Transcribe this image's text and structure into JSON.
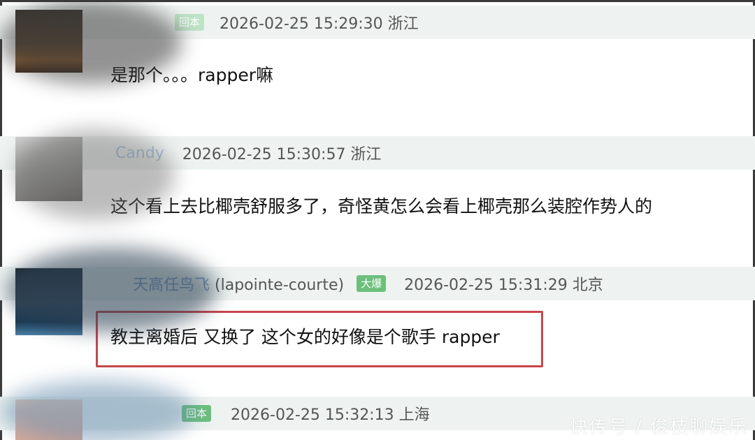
{
  "comments": [
    {
      "username": "",
      "handle": "",
      "badge": "回本",
      "timestamp": "2026-02-25 15:29:30 浙江",
      "text": "是那个。。。rapper嘛"
    },
    {
      "username": "Candy",
      "handle": "",
      "badge": "",
      "timestamp": "2026-02-25 15:30:57 浙江",
      "text": "这个看上去比椰壳舒服多了，奇怪黄怎么会看上椰壳那么装腔作势人的"
    },
    {
      "username": "天高任鸟飞",
      "handle": "(lapointe-courte)",
      "badge": "大爆",
      "timestamp": "2026-02-25 15:31:29 北京",
      "text": "教主离婚后 又换了 这个女的好像是个歌手 rapper"
    },
    {
      "username": "",
      "handle": "",
      "badge": "回本",
      "timestamp": "2026-02-25 15:32:13 上海",
      "text": ""
    }
  ],
  "watermark": "快传号 / 俊枝聊娱乐",
  "colors": {
    "meta_bar": "#eef3f1",
    "badge_green": "#6cbf7c",
    "username_blue": "#4b7fb8",
    "highlight_red": "#c9454a"
  }
}
